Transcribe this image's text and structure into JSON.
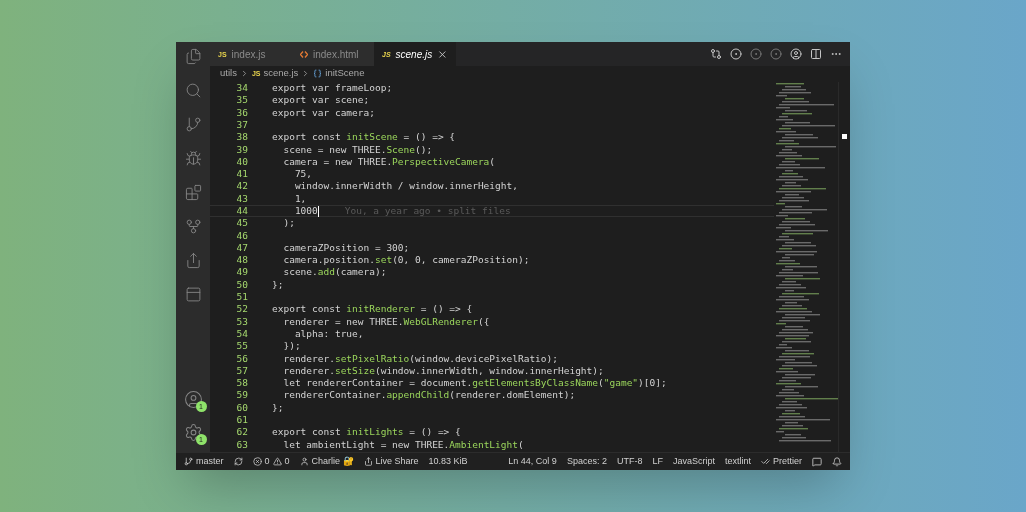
{
  "activity_bar": {
    "top": [
      {
        "kind": "files",
        "selected": false
      },
      {
        "kind": "search",
        "selected": false
      },
      {
        "kind": "source-control",
        "selected": false
      },
      {
        "kind": "debug",
        "selected": false
      },
      {
        "kind": "extensions",
        "selected": false
      },
      {
        "kind": "git-graph",
        "selected": false
      },
      {
        "kind": "share",
        "selected": false
      },
      {
        "kind": "browser",
        "selected": false
      }
    ],
    "bottom": [
      {
        "kind": "account",
        "badge": "1"
      },
      {
        "kind": "settings",
        "badge": "1"
      }
    ]
  },
  "tabs": [
    {
      "label": "index.js",
      "kind": "js",
      "icon": "JS",
      "selected": false
    },
    {
      "label": "index.html",
      "kind": "html",
      "selected": false
    },
    {
      "label": "scene.js",
      "kind": "js",
      "icon": "JS",
      "selected": true
    }
  ],
  "breadcrumb": [
    {
      "label": "utils",
      "kind": "folder"
    },
    {
      "label": "scene.js",
      "kind": "js",
      "icon": "JS"
    },
    {
      "label": "initScene",
      "kind": "symbol"
    }
  ],
  "code_lines": [
    {
      "number": "34",
      "current": false,
      "tokens": [
        {
          "text": "export var frameLoop;",
          "kind": "plain"
        }
      ]
    },
    {
      "number": "35",
      "current": false,
      "tokens": [
        {
          "text": "export var scene;",
          "kind": "plain"
        }
      ]
    },
    {
      "number": "36",
      "current": false,
      "tokens": [
        {
          "text": "export var camera;",
          "kind": "plain"
        }
      ]
    },
    {
      "number": "37",
      "current": false
    },
    {
      "number": "38",
      "current": false,
      "tokens": [
        {
          "text": "export const ",
          "kind": "plain"
        },
        {
          "text": "initScene",
          "kind": "fn"
        },
        {
          "text": " = () => {",
          "kind": "plain"
        }
      ]
    },
    {
      "number": "39",
      "current": false,
      "tokens": [
        {
          "text": "  scene = new THREE.",
          "kind": "plain"
        },
        {
          "text": "Scene",
          "kind": "fn"
        },
        {
          "text": "();",
          "kind": "plain"
        }
      ]
    },
    {
      "number": "40",
      "current": false,
      "tokens": [
        {
          "text": "  camera = new THREE.",
          "kind": "plain"
        },
        {
          "text": "PerspectiveCamera",
          "kind": "fn"
        },
        {
          "text": "(",
          "kind": "plain"
        }
      ]
    },
    {
      "number": "41",
      "current": false,
      "tokens": [
        {
          "text": "    75,",
          "kind": "plain"
        }
      ]
    },
    {
      "number": "42",
      "current": false,
      "tokens": [
        {
          "text": "    window.innerWidth / window.innerHeight,",
          "kind": "plain"
        }
      ]
    },
    {
      "number": "43",
      "current": false,
      "tokens": [
        {
          "text": "    1,",
          "kind": "plain"
        }
      ]
    },
    {
      "number": "44",
      "current": true,
      "blame": "You, a year ago • split files",
      "tokens": [
        {
          "text": "    1000",
          "kind": "plain"
        }
      ]
    },
    {
      "number": "45",
      "current": false,
      "tokens": [
        {
          "text": "  );",
          "kind": "plain"
        }
      ]
    },
    {
      "number": "46",
      "current": false
    },
    {
      "number": "47",
      "current": false,
      "tokens": [
        {
          "text": "  cameraZPosition = 300;",
          "kind": "plain"
        }
      ]
    },
    {
      "number": "48",
      "current": false,
      "tokens": [
        {
          "text": "  camera.position.",
          "kind": "plain"
        },
        {
          "text": "set",
          "kind": "fn"
        },
        {
          "text": "(0, 0, cameraZPosition);",
          "kind": "plain"
        }
      ]
    },
    {
      "number": "49",
      "current": false,
      "tokens": [
        {
          "text": "  scene.",
          "kind": "plain"
        },
        {
          "text": "add",
          "kind": "fn"
        },
        {
          "text": "(camera);",
          "kind": "plain"
        }
      ]
    },
    {
      "number": "50",
      "current": false,
      "tokens": [
        {
          "text": "};",
          "kind": "plain"
        }
      ]
    },
    {
      "number": "51",
      "current": false
    },
    {
      "number": "52",
      "current": false,
      "tokens": [
        {
          "text": "export const ",
          "kind": "plain"
        },
        {
          "text": "initRenderer",
          "kind": "fn"
        },
        {
          "text": " = () => {",
          "kind": "plain"
        }
      ]
    },
    {
      "number": "53",
      "current": false,
      "tokens": [
        {
          "text": "  renderer = new THREE.",
          "kind": "plain"
        },
        {
          "text": "WebGLRenderer",
          "kind": "fn"
        },
        {
          "text": "({",
          "kind": "plain"
        }
      ]
    },
    {
      "number": "54",
      "current": false,
      "tokens": [
        {
          "text": "    alpha: true,",
          "kind": "plain"
        }
      ]
    },
    {
      "number": "55",
      "current": false,
      "tokens": [
        {
          "text": "  });",
          "kind": "plain"
        }
      ]
    },
    {
      "number": "56",
      "current": false,
      "tokens": [
        {
          "text": "  renderer.",
          "kind": "plain"
        },
        {
          "text": "setPixelRatio",
          "kind": "fn"
        },
        {
          "text": "(window.devicePixelRatio);",
          "kind": "plain"
        }
      ]
    },
    {
      "number": "57",
      "current": false,
      "tokens": [
        {
          "text": "  renderer.",
          "kind": "plain"
        },
        {
          "text": "setSize",
          "kind": "fn"
        },
        {
          "text": "(window.innerWidth, window.innerHeight);",
          "kind": "plain"
        }
      ]
    },
    {
      "number": "58",
      "current": false,
      "tokens": [
        {
          "text": "  let rendererContainer = document.",
          "kind": "plain"
        },
        {
          "text": "getElementsByClassName",
          "kind": "fn"
        },
        {
          "text": "(",
          "kind": "plain"
        },
        {
          "text": "\"game\"",
          "kind": "fn"
        },
        {
          "text": ")[0];",
          "kind": "plain"
        }
      ]
    },
    {
      "number": "59",
      "current": false,
      "tokens": [
        {
          "text": "  rendererContainer.",
          "kind": "plain"
        },
        {
          "text": "appendChild",
          "kind": "fn"
        },
        {
          "text": "(renderer.domElement);",
          "kind": "plain"
        }
      ]
    },
    {
      "number": "60",
      "current": false,
      "tokens": [
        {
          "text": "};",
          "kind": "plain"
        }
      ]
    },
    {
      "number": "61",
      "current": false
    },
    {
      "number": "62",
      "current": false,
      "tokens": [
        {
          "text": "export const ",
          "kind": "plain"
        },
        {
          "text": "initLights",
          "kind": "fn"
        },
        {
          "text": " = () => {",
          "kind": "plain"
        }
      ]
    },
    {
      "number": "63",
      "current": false,
      "tokens": [
        {
          "text": "  let ambientLight = new THREE.",
          "kind": "plain"
        },
        {
          "text": "AmbientLight",
          "kind": "fn"
        },
        {
          "text": "(",
          "kind": "plain"
        }
      ]
    }
  ],
  "status_bar": {
    "left": [
      {
        "kind": "branch",
        "text": "master"
      },
      {
        "kind": "sync"
      },
      {
        "kind": "problems",
        "errors": "0",
        "warnings": "0"
      },
      {
        "kind": "user",
        "text": "Charlie 🔐"
      },
      {
        "kind": "share",
        "text": "Live Share"
      },
      {
        "kind": "plain",
        "text": "10.83 KiB"
      }
    ],
    "right": [
      {
        "kind": "plain",
        "text": "Ln 44, Col 9"
      },
      {
        "kind": "plain",
        "text": "Spaces: 2"
      },
      {
        "kind": "plain",
        "text": "UTF-8"
      },
      {
        "kind": "plain",
        "text": "LF"
      },
      {
        "kind": "plain",
        "text": "JavaScript"
      },
      {
        "kind": "plain",
        "text": "textlint"
      },
      {
        "kind": "check",
        "text": "Prettier"
      },
      {
        "kind": "feedback"
      },
      {
        "kind": "bell"
      }
    ]
  }
}
